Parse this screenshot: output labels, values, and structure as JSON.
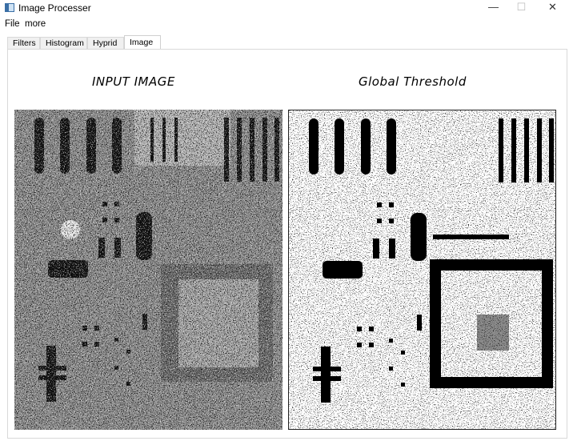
{
  "window": {
    "title": "Image Processer",
    "minimize_label": "—",
    "maximize_label": "☐",
    "close_label": "✕"
  },
  "menu": {
    "items": [
      "File",
      "more"
    ]
  },
  "tabs": {
    "items": [
      "Filters",
      "Histogram",
      "Hyprid",
      "Image"
    ],
    "active": "Image"
  },
  "panel": {
    "input_caption": "INPUT IMAGE",
    "output_caption": "Global Threshold"
  }
}
